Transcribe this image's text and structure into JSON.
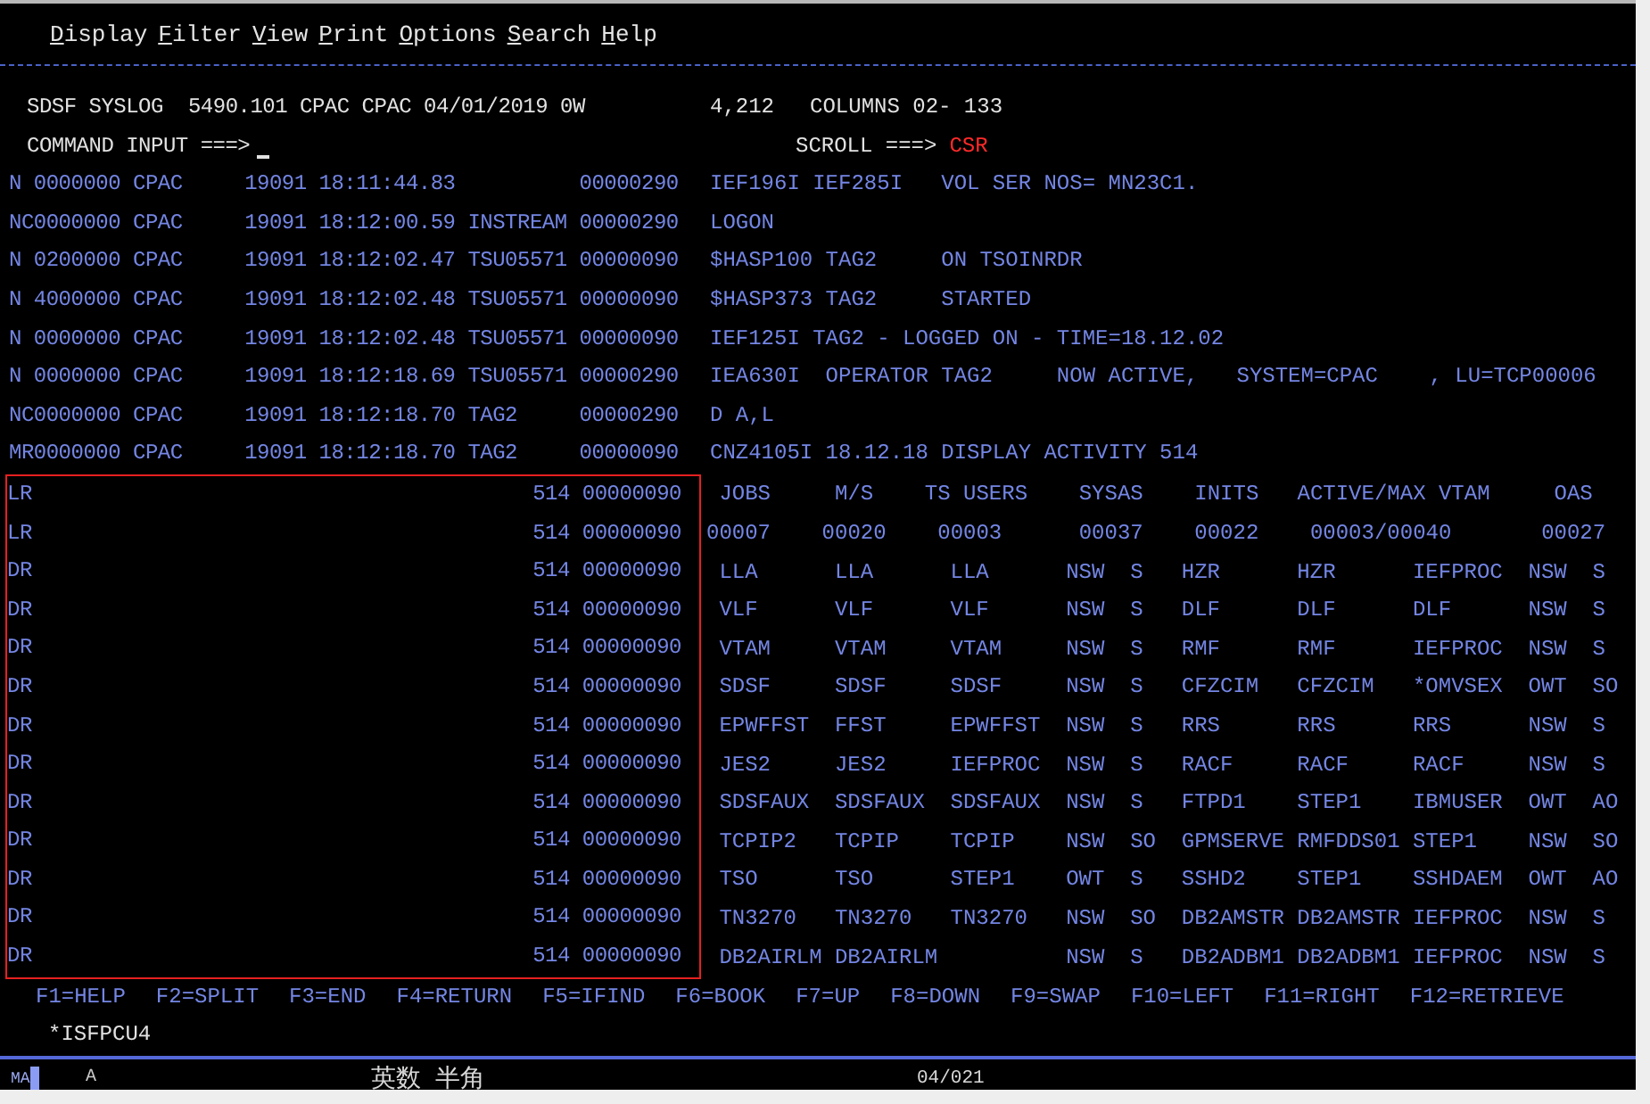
{
  "menu": [
    "Display",
    "Filter",
    "View",
    "Print",
    "Options",
    "Search",
    "Help"
  ],
  "header": {
    "title": "SDSF SYSLOG",
    "info": "5490.101 CPAC CPAC 04/01/2019 0W",
    "line_count": "4,212",
    "columns": "COLUMNS 02- 133",
    "command_label": "COMMAND INPUT ===>",
    "scroll_label": "SCROLL ===>",
    "scroll_value": "CSR"
  },
  "log_rows": [
    {
      "prefix": "N 0000000 CPAC     19091 18:11:44.83          00000290",
      "message": "IEF196I IEF285I   VOL SER NOS= MN23C1."
    },
    {
      "prefix": "NC0000000 CPAC     19091 18:12:00.59 INSTREAM 00000290",
      "message": "LOGON"
    },
    {
      "prefix": "N 0200000 CPAC     19091 18:12:02.47 TSU05571 00000090",
      "message": "$HASP100 TAG2     ON TSOINRDR"
    },
    {
      "prefix": "N 4000000 CPAC     19091 18:12:02.48 TSU05571 00000090",
      "message": "$HASP373 TAG2     STARTED"
    },
    {
      "prefix": "N 0000000 CPAC     19091 18:12:02.48 TSU05571 00000090",
      "message": "IEF125I TAG2 - LOGGED ON - TIME=18.12.02"
    },
    {
      "prefix": "N 0000000 CPAC     19091 18:12:18.69 TSU05571 00000290",
      "message": "IEA630I  OPERATOR TAG2     NOW ACTIVE,   SYSTEM=CPAC    , LU=TCP00006"
    },
    {
      "prefix": "NC0000000 CPAC     19091 18:12:18.70 TAG2     00000290",
      "message": "D A,L"
    },
    {
      "prefix": "MR0000000 CPAC     19091 18:12:18.70 TAG2     00000090",
      "message": "CNZ4105I 18.12.18 DISPLAY ACTIVITY 514"
    }
  ],
  "activity": {
    "highlighted": true,
    "rows": [
      {
        "flag": "LR",
        "ref": "514 00000090",
        "kind": "text",
        "text": " JOBS     M/S    TS USERS    SYSAS    INITS   ACTIVE/MAX VTAM     OAS"
      },
      {
        "flag": "LR",
        "ref": "514 00000090",
        "kind": "text",
        "text": "00007    00020    00003      00037    00022    00003/00040       00027"
      },
      {
        "flag": "DR",
        "ref": "514 00000090",
        "kind": "job",
        "cells": [
          "LLA",
          "LLA",
          "LLA",
          "NSW",
          "S",
          "HZR",
          "HZR",
          "IEFPROC",
          "NSW",
          "S"
        ]
      },
      {
        "flag": "DR",
        "ref": "514 00000090",
        "kind": "job",
        "cells": [
          "VLF",
          "VLF",
          "VLF",
          "NSW",
          "S",
          "DLF",
          "DLF",
          "DLF",
          "NSW",
          "S"
        ]
      },
      {
        "flag": "DR",
        "ref": "514 00000090",
        "kind": "job",
        "cells": [
          "VTAM",
          "VTAM",
          "VTAM",
          "NSW",
          "S",
          "RMF",
          "RMF",
          "IEFPROC",
          "NSW",
          "S"
        ]
      },
      {
        "flag": "DR",
        "ref": "514 00000090",
        "kind": "job",
        "cells": [
          "SDSF",
          "SDSF",
          "SDSF",
          "NSW",
          "S",
          "CFZCIM",
          "CFZCIM",
          "*OMVSEX",
          "OWT",
          "SO"
        ]
      },
      {
        "flag": "DR",
        "ref": "514 00000090",
        "kind": "job",
        "cells": [
          "EPWFFST",
          "FFST",
          "EPWFFST",
          "NSW",
          "S",
          "RRS",
          "RRS",
          "RRS",
          "NSW",
          "S"
        ]
      },
      {
        "flag": "DR",
        "ref": "514 00000090",
        "kind": "job",
        "cells": [
          "JES2",
          "JES2",
          "IEFPROC",
          "NSW",
          "S",
          "RACF",
          "RACF",
          "RACF",
          "NSW",
          "S"
        ]
      },
      {
        "flag": "DR",
        "ref": "514 00000090",
        "kind": "job",
        "cells": [
          "SDSFAUX",
          "SDSFAUX",
          "SDSFAUX",
          "NSW",
          "S",
          "FTPD1",
          "STEP1",
          "IBMUSER",
          "OWT",
          "AO"
        ]
      },
      {
        "flag": "DR",
        "ref": "514 00000090",
        "kind": "job",
        "cells": [
          "TCPIP2",
          "TCPIP",
          "TCPIP",
          "NSW",
          "SO",
          "GPMSERVE",
          "RMFDDS01",
          "STEP1",
          "NSW",
          "SO"
        ]
      },
      {
        "flag": "DR",
        "ref": "514 00000090",
        "kind": "job",
        "cells": [
          "TSO",
          "TSO",
          "STEP1",
          "OWT",
          "S",
          "SSHD2",
          "STEP1",
          "SSHDAEM",
          "OWT",
          "AO"
        ]
      },
      {
        "flag": "DR",
        "ref": "514 00000090",
        "kind": "job",
        "cells": [
          "TN3270",
          "TN3270",
          "TN3270",
          "NSW",
          "SO",
          "DB2AMSTR",
          "DB2AMSTR",
          "IEFPROC",
          "NSW",
          "S"
        ]
      },
      {
        "flag": "DR",
        "ref": "514 00000090",
        "kind": "job",
        "cells": [
          "DB2AIRLM",
          "DB2AIRLM",
          null,
          "NSW",
          "S",
          "DB2ADBM1",
          "DB2ADBM1",
          "IEFPROC",
          "NSW",
          "S"
        ]
      }
    ]
  },
  "function_keys": [
    "F1=HELP",
    "F2=SPLIT",
    "F3=END",
    "F4=RETURN",
    "F5=IFIND",
    "F6=BOOK",
    "F7=UP",
    "F8=DOWN",
    "F9=SWAP",
    "F10=LEFT",
    "F11=RIGHT",
    "F12=RETRIEVE"
  ],
  "footer_text": "*ISFPCU4",
  "status_bar": {
    "mode": "MA",
    "field": "A",
    "input_modes": [
      "英数",
      "半角"
    ],
    "position": "04/021"
  }
}
